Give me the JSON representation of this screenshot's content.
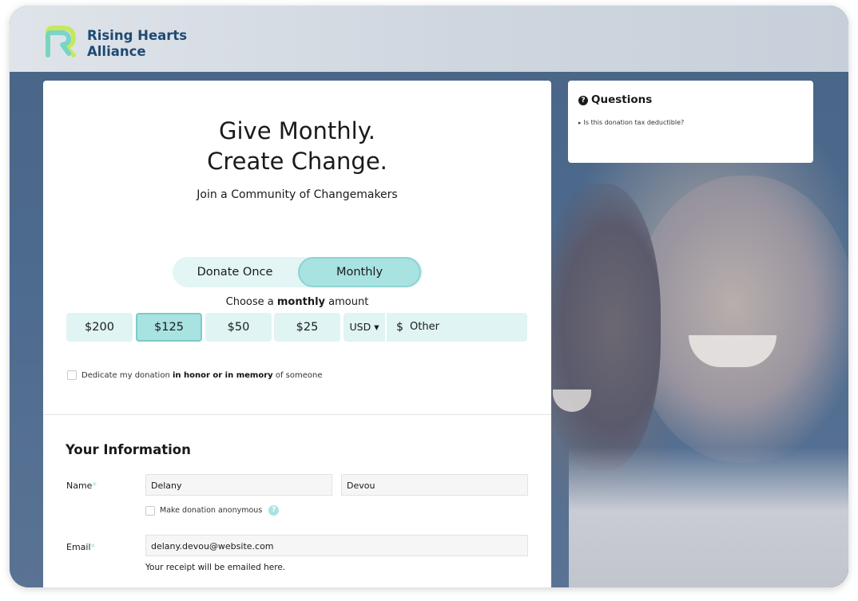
{
  "brand": {
    "line1": "Rising Hearts",
    "line2": "Alliance",
    "primary_color": "#1e4a73",
    "logo_colors": [
      "#6fd3c9",
      "#c7e85a"
    ]
  },
  "hero": {
    "title_line1": "Give Monthly.",
    "title_line2": "Create Change.",
    "subtitle": "Join a Community of Changemakers"
  },
  "frequency": {
    "options": [
      "Donate Once",
      "Monthly"
    ],
    "selected": "Monthly"
  },
  "amount": {
    "prompt_prefix": "Choose a",
    "prompt_bold": "monthly",
    "prompt_suffix": "amount",
    "options": [
      "$200",
      "$125",
      "$50",
      "$25"
    ],
    "selected": "$125",
    "currency": "USD",
    "currency_caret": "▾",
    "other_symbol": "$",
    "other_placeholder": "Other"
  },
  "dedicate": {
    "prefix": "Dedicate my donation",
    "bold": "in honor or in memory",
    "suffix": "of someone",
    "checked": false
  },
  "your_info": {
    "heading": "Your Information",
    "name_label": "Name",
    "required_mark": "*",
    "first_name": "Delany",
    "last_name": "Devou",
    "anonymous_label": "Make donation anonymous",
    "anonymous_help": "?",
    "email_label": "Email",
    "email": "delany.devou@website.com",
    "email_hint": "Your receipt will be emailed here."
  },
  "questions": {
    "title": "Questions",
    "icon": "?",
    "items": [
      "Is this donation tax deductible?"
    ]
  },
  "colors": {
    "accent_light": "#e0f4f4",
    "accent": "#a8e2e1",
    "accent_border": "#7ccbc9"
  }
}
